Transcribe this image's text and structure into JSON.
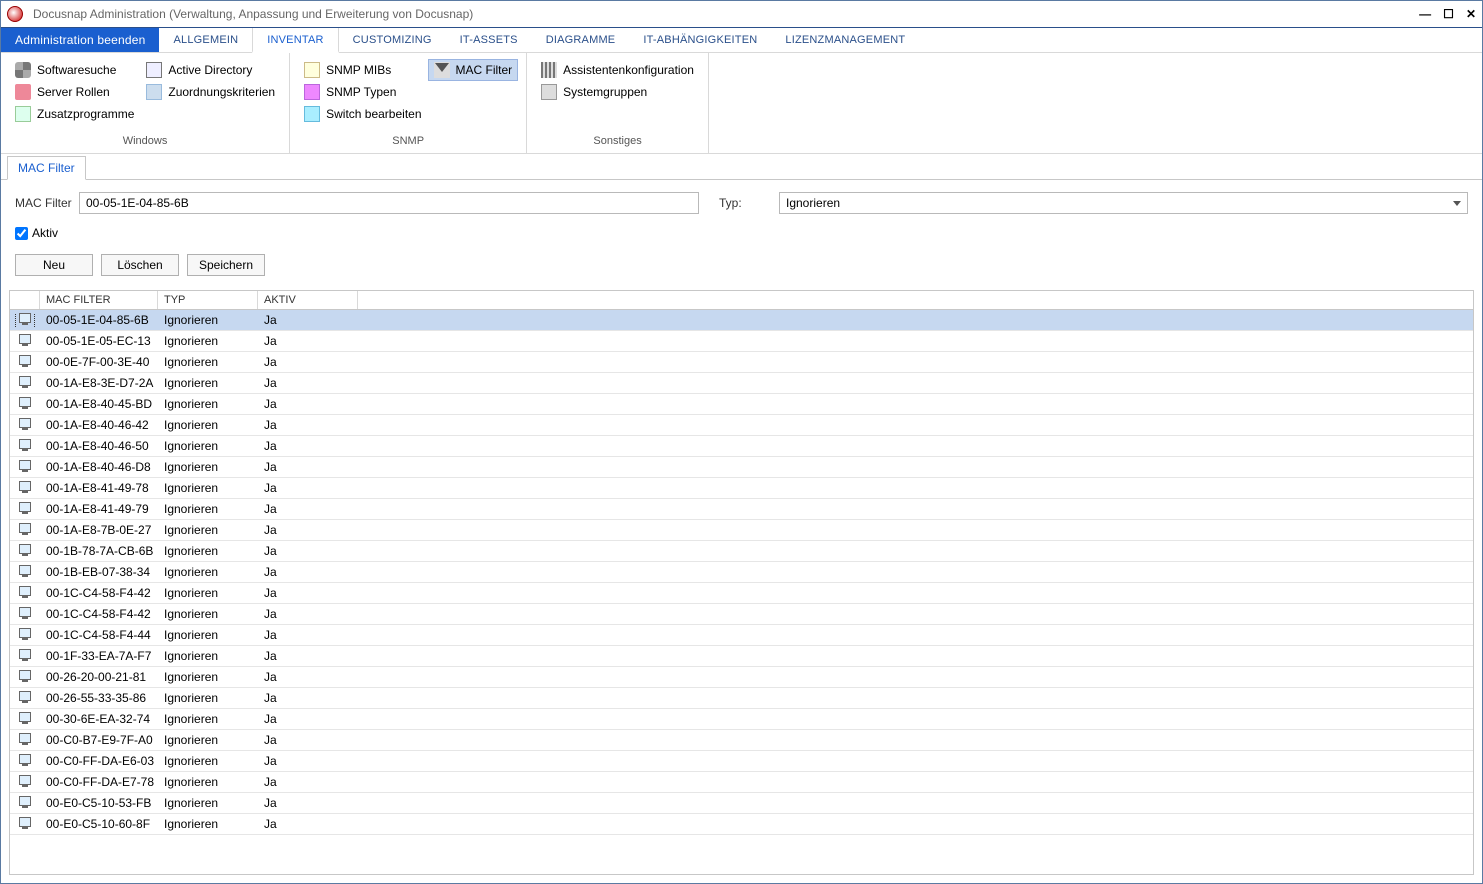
{
  "window": {
    "title": "Docusnap Administration (Verwaltung, Anpassung und Erweiterung von Docusnap)"
  },
  "menu": {
    "admin_end": "Administration beenden",
    "items": [
      "ALLGEMEIN",
      "INVENTAR",
      "CUSTOMIZING",
      "IT-ASSETS",
      "DIAGRAMME",
      "IT-ABHÄNGIGKEITEN",
      "LIZENZMANAGEMENT"
    ],
    "active_index": 1
  },
  "ribbon": {
    "groups": [
      {
        "label": "Windows",
        "items": [
          {
            "label": "Softwaresuche",
            "icon": "gear"
          },
          {
            "label": "Server Rollen",
            "icon": "roles"
          },
          {
            "label": "Zusatzprogramme",
            "icon": "zusatz"
          },
          {
            "label": "Active Directory",
            "icon": "ad"
          },
          {
            "label": "Zuordnungskriterien",
            "icon": "zuord"
          }
        ]
      },
      {
        "label": "SNMP",
        "items": [
          {
            "label": "SNMP MIBs",
            "icon": "mib"
          },
          {
            "label": "SNMP Typen",
            "icon": "types"
          },
          {
            "label": "Switch bearbeiten",
            "icon": "switch"
          },
          {
            "label": "MAC Filter",
            "icon": "filter",
            "selected": true
          }
        ]
      },
      {
        "label": "Sonstiges",
        "items": [
          {
            "label": "Assistentenkonfiguration",
            "icon": "wiz"
          },
          {
            "label": "Systemgruppen",
            "icon": "sys"
          }
        ]
      }
    ]
  },
  "tab": {
    "label": "MAC Filter"
  },
  "form": {
    "mac_label": "MAC Filter",
    "mac_value": "00-05-1E-04-85-6B",
    "typ_label": "Typ:",
    "typ_value": "Ignorieren",
    "aktiv_label": "Aktiv",
    "aktiv_checked": true,
    "buttons": {
      "neu": "Neu",
      "loeschen": "Löschen",
      "speichern": "Speichern"
    }
  },
  "grid": {
    "headers": {
      "mac": "MAC Filter",
      "typ": "Typ",
      "aktiv": "Aktiv"
    },
    "rows": [
      {
        "mac": "00-05-1E-04-85-6B",
        "typ": "Ignorieren",
        "aktiv": "Ja",
        "selected": true
      },
      {
        "mac": "00-05-1E-05-EC-13",
        "typ": "Ignorieren",
        "aktiv": "Ja"
      },
      {
        "mac": "00-0E-7F-00-3E-40",
        "typ": "Ignorieren",
        "aktiv": "Ja"
      },
      {
        "mac": "00-1A-E8-3E-D7-2A",
        "typ": "Ignorieren",
        "aktiv": "Ja"
      },
      {
        "mac": "00-1A-E8-40-45-BD",
        "typ": "Ignorieren",
        "aktiv": "Ja"
      },
      {
        "mac": "00-1A-E8-40-46-42",
        "typ": "Ignorieren",
        "aktiv": "Ja"
      },
      {
        "mac": "00-1A-E8-40-46-50",
        "typ": "Ignorieren",
        "aktiv": "Ja"
      },
      {
        "mac": "00-1A-E8-40-46-D8",
        "typ": "Ignorieren",
        "aktiv": "Ja"
      },
      {
        "mac": "00-1A-E8-41-49-78",
        "typ": "Ignorieren",
        "aktiv": "Ja"
      },
      {
        "mac": "00-1A-E8-41-49-79",
        "typ": "Ignorieren",
        "aktiv": "Ja"
      },
      {
        "mac": "00-1A-E8-7B-0E-27",
        "typ": "Ignorieren",
        "aktiv": "Ja"
      },
      {
        "mac": "00-1B-78-7A-CB-6B",
        "typ": "Ignorieren",
        "aktiv": "Ja"
      },
      {
        "mac": "00-1B-EB-07-38-34",
        "typ": "Ignorieren",
        "aktiv": "Ja"
      },
      {
        "mac": "00-1C-C4-58-F4-42",
        "typ": "Ignorieren",
        "aktiv": "Ja"
      },
      {
        "mac": "00-1C-C4-58-F4-42",
        "typ": "Ignorieren",
        "aktiv": "Ja"
      },
      {
        "mac": "00-1C-C4-58-F4-44",
        "typ": "Ignorieren",
        "aktiv": "Ja"
      },
      {
        "mac": "00-1F-33-EA-7A-F7",
        "typ": "Ignorieren",
        "aktiv": "Ja"
      },
      {
        "mac": "00-26-20-00-21-81",
        "typ": "Ignorieren",
        "aktiv": "Ja"
      },
      {
        "mac": "00-26-55-33-35-86",
        "typ": "Ignorieren",
        "aktiv": "Ja"
      },
      {
        "mac": "00-30-6E-EA-32-74",
        "typ": "Ignorieren",
        "aktiv": "Ja"
      },
      {
        "mac": "00-C0-B7-E9-7F-A0",
        "typ": "Ignorieren",
        "aktiv": "Ja"
      },
      {
        "mac": "00-C0-FF-DA-E6-03",
        "typ": "Ignorieren",
        "aktiv": "Ja"
      },
      {
        "mac": "00-C0-FF-DA-E7-78",
        "typ": "Ignorieren",
        "aktiv": "Ja"
      },
      {
        "mac": "00-E0-C5-10-53-FB",
        "typ": "Ignorieren",
        "aktiv": "Ja"
      },
      {
        "mac": "00-E0-C5-10-60-8F",
        "typ": "Ignorieren",
        "aktiv": "Ja"
      }
    ]
  }
}
